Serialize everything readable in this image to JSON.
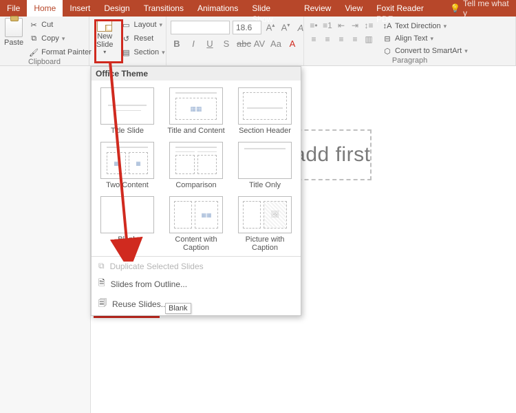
{
  "tabs": {
    "file": "File",
    "home": "Home",
    "insert": "Insert",
    "design": "Design",
    "transitions": "Transitions",
    "animations": "Animations",
    "slideshow": "Slide Show",
    "review": "Review",
    "view": "View",
    "foxit": "Foxit Reader PDF",
    "tellme": "Tell me what y"
  },
  "clipboard": {
    "paste": "Paste",
    "cut": "Cut",
    "copy": "Copy",
    "format_painter": "Format Painter",
    "group": "Clipboard"
  },
  "slides": {
    "new_slide": "New\nSlide",
    "layout": "Layout",
    "reset": "Reset",
    "section": "Section"
  },
  "font": {
    "size": "18.6"
  },
  "paragraph": {
    "group": "Paragraph",
    "text_direction": "Text Direction",
    "align_text": "Align Text",
    "smartart": "Convert to SmartArt"
  },
  "gallery": {
    "title": "Office Theme",
    "items": {
      "title_slide": "Title Slide",
      "title_content": "Title and Content",
      "section_header": "Section Header",
      "two_content": "Two Content",
      "comparison": "Comparison",
      "title_only": "Title Only",
      "blank": "Blank",
      "content_caption": "Content with\nCaption",
      "picture_caption": "Picture with\nCaption"
    },
    "tooltip": "Blank",
    "dup": "Duplicate Selected Slides",
    "outline": "Slides from Outline...",
    "reuse": "Reuse Slides..."
  },
  "slide_placeholder": "Click to add first"
}
